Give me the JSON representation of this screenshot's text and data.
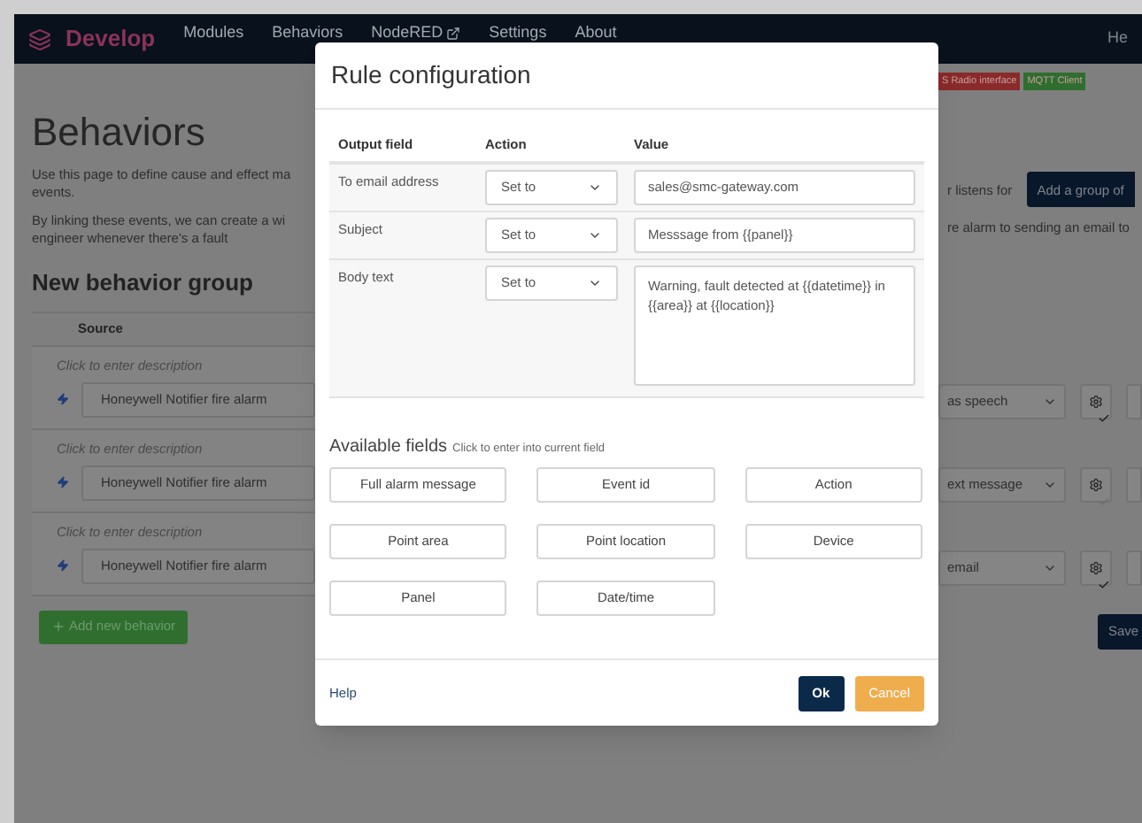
{
  "nav": {
    "brand": "Develop",
    "items": [
      {
        "label": "Modules",
        "external": false
      },
      {
        "label": "Behaviors",
        "external": false
      },
      {
        "label": "NodeRED",
        "external": true
      },
      {
        "label": "Settings",
        "external": false
      },
      {
        "label": "About",
        "external": false
      }
    ],
    "user": "He"
  },
  "badges": [
    {
      "label": "S Radio interface",
      "color": "#8a2a2a"
    },
    {
      "label": "MQTT Client",
      "color": "#2f6e2f"
    }
  ],
  "page": {
    "title": "Behaviors",
    "intro_left": [
      "Use this page to define cause and effect ma",
      "events.",
      "By linking these events, we can create a wi",
      "engineer whenever there's a fault"
    ],
    "intro_right": [
      "r listens for",
      "re alarm to sending an email to"
    ],
    "add_group_button": "Add a group of",
    "group_title": "New behavior group",
    "source_header": "Source",
    "behaviors": [
      {
        "description": "Click to enter description",
        "source": "Honeywell Notifier fire alarm",
        "action": "as speech",
        "checked": true
      },
      {
        "description": "Click to enter description",
        "source": "Honeywell Notifier fire alarm",
        "action": "ext message",
        "checked": false
      },
      {
        "description": "Click to enter description",
        "source": "Honeywell Notifier fire alarm",
        "action": "email",
        "checked": true
      }
    ],
    "add_behavior_button": "Add new behavior",
    "save_button": "Save"
  },
  "modal": {
    "title": "Rule configuration",
    "columns": [
      "Output field",
      "Action",
      "Value"
    ],
    "rows": [
      {
        "field": "To email address",
        "action": "Set to",
        "value": "sales@smc-gateway.com",
        "kind": "input"
      },
      {
        "field": "Subject",
        "action": "Set to",
        "value": "Messsage from {{panel}}",
        "kind": "input"
      },
      {
        "field": "Body text",
        "action": "Set to",
        "value": "Warning, fault detected at {{datetime}} in {{area}} at {{location}}",
        "kind": "textarea"
      }
    ],
    "available_title": "Available fields",
    "available_hint": "Click to enter into current field",
    "fields": [
      "Full alarm message",
      "Event id",
      "Action",
      "Point area",
      "Point location",
      "Device",
      "Panel",
      "Date/time"
    ],
    "help": "Help",
    "ok": "Ok",
    "cancel": "Cancel"
  }
}
